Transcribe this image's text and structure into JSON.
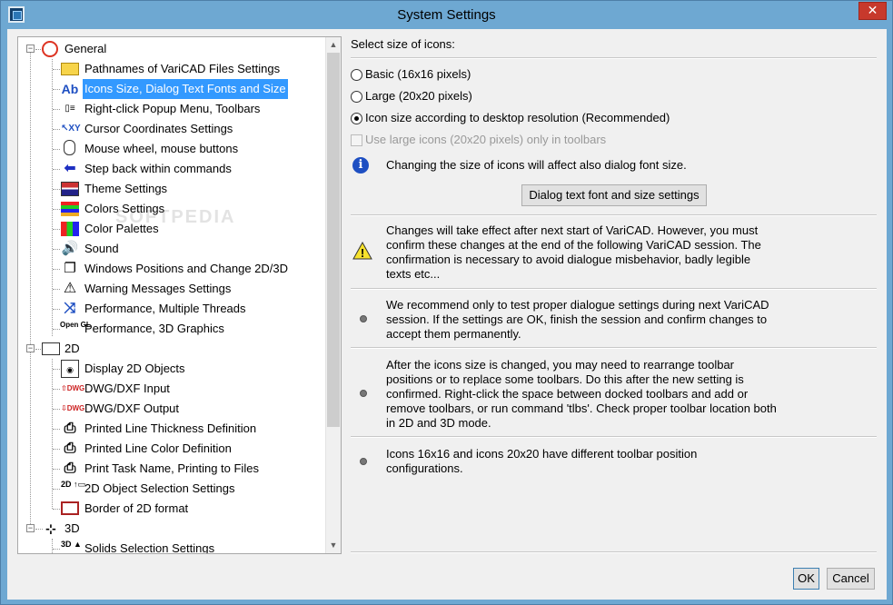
{
  "window": {
    "title": "System Settings"
  },
  "tree": {
    "general": {
      "label": "General",
      "items": [
        {
          "label": "Pathnames of VariCAD Files Settings",
          "icon": "folder-icon"
        },
        {
          "label": "Icons Size, Dialog Text Fonts and Size",
          "icon": "ab-font-icon",
          "selected": true
        },
        {
          "label": "Right-click Popup Menu, Toolbars",
          "icon": "popup-menu-icon"
        },
        {
          "label": "Cursor Coordinates Settings",
          "icon": "cursor-xy-icon"
        },
        {
          "label": "Mouse wheel, mouse buttons",
          "icon": "mouse-icon"
        },
        {
          "label": "Step back within commands",
          "icon": "arrow-left-icon"
        },
        {
          "label": "Theme Settings",
          "icon": "theme-icon"
        },
        {
          "label": "Colors Settings",
          "icon": "colors-icon"
        },
        {
          "label": "Color Palettes",
          "icon": "palette-icon"
        },
        {
          "label": "Sound",
          "icon": "speaker-icon"
        },
        {
          "label": "Windows Positions and Change 2D/3D",
          "icon": "windows-icon"
        },
        {
          "label": "Warning Messages Settings",
          "icon": "warning-icon"
        },
        {
          "label": "Performance, Multiple Threads",
          "icon": "threads-icon"
        },
        {
          "label": "Performance, 3D Graphics",
          "icon": "opengl-icon"
        }
      ]
    },
    "group_2d": {
      "label": "2D",
      "items": [
        {
          "label": "Display 2D Objects",
          "icon": "display-2d-icon"
        },
        {
          "label": "DWG/DXF Input",
          "icon": "dwg-input-icon"
        },
        {
          "label": "DWG/DXF Output",
          "icon": "dwg-output-icon"
        },
        {
          "label": "Printed Line Thickness Definition",
          "icon": "printer-icon"
        },
        {
          "label": "Printed Line Color Definition",
          "icon": "printer-icon"
        },
        {
          "label": "Print Task Name, Printing to Files",
          "icon": "printer-icon"
        },
        {
          "label": "2D Object Selection Settings",
          "icon": "selection-2d-icon"
        },
        {
          "label": "Border of 2D format",
          "icon": "border-icon"
        }
      ]
    },
    "group_3d": {
      "label": "3D",
      "items": [
        {
          "label": "Solids Selection Settings",
          "icon": "selection-3d-icon"
        }
      ]
    },
    "opengl_text": "Open GL"
  },
  "settings": {
    "heading": "Select size of icons:",
    "options": [
      {
        "label": "Basic (16x16 pixels)",
        "checked": false
      },
      {
        "label": "Large (20x20 pixels)",
        "checked": false
      },
      {
        "label": "Icon size according to desktop resolution (Recommended)",
        "checked": true
      }
    ],
    "toolbar_checkbox": {
      "label": "Use large icons (20x20 pixels) only in toolbars",
      "enabled": false
    },
    "info_text": "Changing the size of icons will affect also dialog font size.",
    "font_button": "Dialog text font and size settings",
    "warning_text": "Changes will take effect after next start of VariCAD. However, you must confirm these changes at the end of the following VariCAD session. The confirmation is necessary to avoid dialogue misbehavior, badly legible texts etc...",
    "notes": [
      "We recommend only to test proper dialogue settings during next VariCAD session. If the settings are OK, finish the session and confirm changes to accept them permanently.",
      "After the icons size is changed, you may need to rearrange toolbar positions or to replace some toolbars. Do this after the new setting is confirmed. Right-click the space between docked toolbars and add or remove toolbars, or run command 'tlbs'. Check proper toolbar location both in 2D and 3D mode.",
      "Icons 16x16 and icons 20x20 have different toolbar position configurations."
    ]
  },
  "buttons": {
    "ok": "OK",
    "cancel": "Cancel"
  },
  "watermark": "SOFTPEDIA"
}
